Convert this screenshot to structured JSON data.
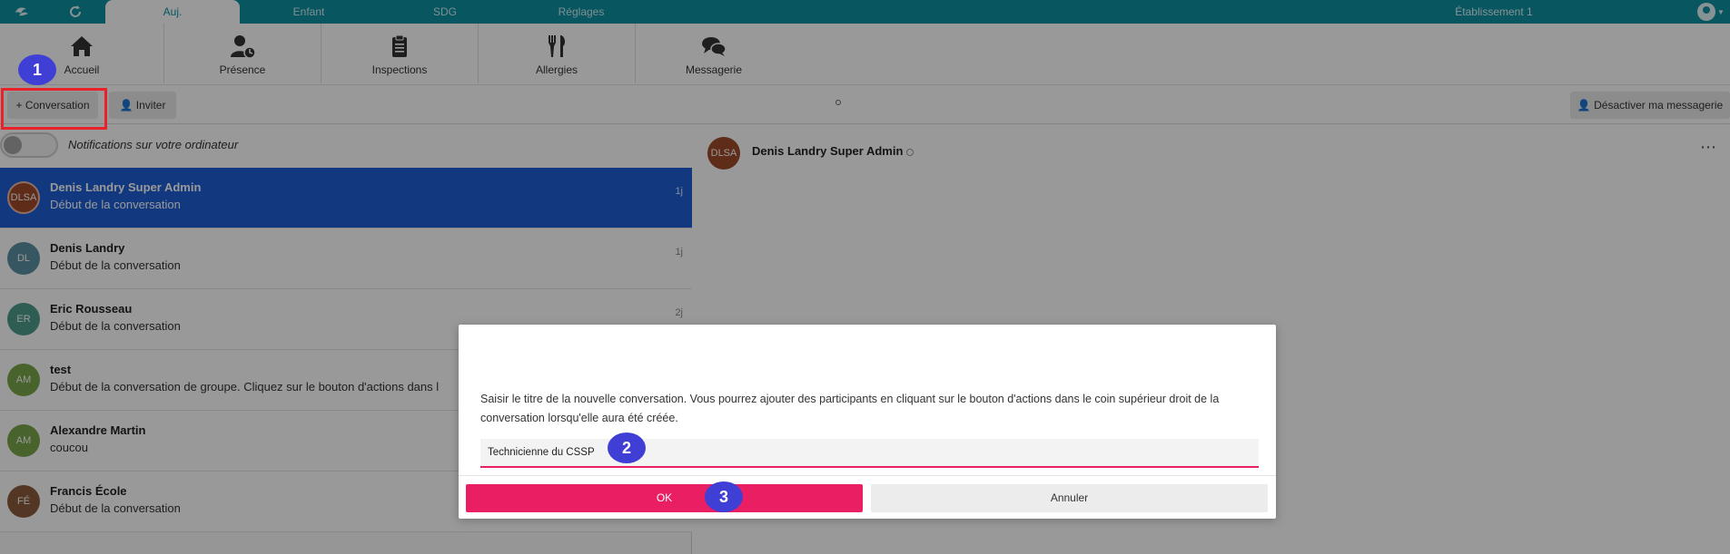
{
  "topbar": {
    "tabs": [
      "Auj.",
      "Enfant",
      "SDG",
      "Réglages"
    ],
    "establishment": "Établissement 1",
    "accent": "#0e8fa0"
  },
  "nav": {
    "items": [
      {
        "label": "Accueil",
        "icon": "home-icon"
      },
      {
        "label": "Présence",
        "icon": "presence-icon"
      },
      {
        "label": "Inspections",
        "icon": "clipboard-icon"
      },
      {
        "label": "Allergies",
        "icon": "utensils-icon"
      },
      {
        "label": "Messagerie",
        "icon": "chat-icon"
      }
    ]
  },
  "actions": {
    "new_conversation": "Conversation",
    "invite": "Inviter",
    "disable_messaging": "Désactiver ma messagerie"
  },
  "notifications": {
    "label": "Notifications sur votre ordinateur"
  },
  "conversations": [
    {
      "initials": "DLSA",
      "name": "Denis Landry Super Admin",
      "message": "Début de la conversation",
      "time": "1j",
      "color": "#a04a2c",
      "active": true
    },
    {
      "initials": "DL",
      "name": "Denis Landry",
      "message": "Début de la conversation",
      "time": "1j",
      "color": "#5b8fa3"
    },
    {
      "initials": "ER",
      "name": "Eric Rousseau",
      "message": "Début de la conversation",
      "time": "2j",
      "color": "#4d9c8a"
    },
    {
      "initials": "AM",
      "name": "test",
      "message": "Début de la conversation de groupe. Cliquez sur le bouton d'actions dans l",
      "time": "",
      "color": "#7aa54a"
    },
    {
      "initials": "AM",
      "name": "Alexandre Martin",
      "message": "coucou",
      "time": "",
      "color": "#7aa54a"
    },
    {
      "initials": "FÉ",
      "name": "Francis École",
      "message": "Début de la conversation",
      "time": "",
      "color": "#8a5a3c"
    }
  ],
  "conversation_header": {
    "initials": "DLSA",
    "name": "Denis Landry Super Admin",
    "more": "⋯"
  },
  "dialog": {
    "description": "Saisir le titre de la nouvelle conversation. Vous pourrez ajouter des participants en cliquant sur le bouton d'actions dans le coin supérieur droit de la conversation lorsqu'elle aura été créée.",
    "input_value": "Technicienne du CSSP",
    "ok_label": "OK",
    "cancel_label": "Annuler",
    "primary_color": "#e91e63"
  },
  "annotations": [
    "1",
    "2",
    "3"
  ]
}
